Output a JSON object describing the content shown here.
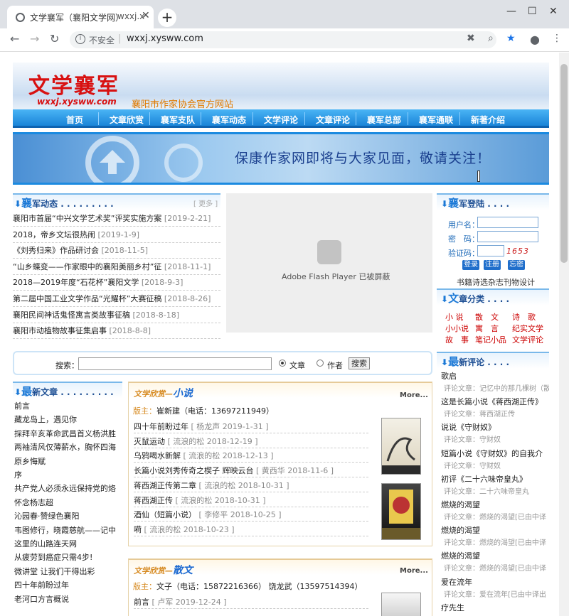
{
  "browser": {
    "tab_title": "文学襄军（襄阳文学网）",
    "tab2_title": "wxxj.x",
    "url": "wxxj.xysww.com",
    "insecure_label": "不安全"
  },
  "header": {
    "logo": "文学襄军",
    "logo_url": "wxxj.xysww.com",
    "slogan": "襄阳市作家协会官方网站"
  },
  "nav": [
    "首页",
    "文章欣赏",
    "襄军支队",
    "襄军动态",
    "文学评论",
    "文章评论",
    "襄军总部",
    "襄军通联",
    "新著介绍"
  ],
  "hero": {
    "text": "保康作家网即将与大家见面，敬请关注！"
  },
  "news": {
    "title_big": "襄",
    "title_rest": "军动态",
    "dots": ". . . . . . . . .",
    "more": "[ 更多 ]",
    "items": [
      {
        "text": "襄阳市首届“中兴文学艺术奖”评奖实施方案",
        "date": "[2019-2-21]"
      },
      {
        "text": "2018，帝乡文坛很热闹",
        "date": "[2019-1-9]"
      },
      {
        "text": "《刘秀归来》作品研讨会",
        "date": "[2018-11-5]"
      },
      {
        "text": "“山乡蝶变——作家眼中的襄阳美丽乡村”征",
        "date": "[2018-11-1]"
      },
      {
        "text": "2018—2019年度“石花杯”襄阳文学",
        "date": "[2018-9-3]"
      },
      {
        "text": "第二届中国工业文学作品“光耀杯”大赛征稿",
        "date": "[2018-8-26]"
      },
      {
        "text": "襄阳民间神话鬼怪寓言类故事征稿",
        "date": "[2018-8-18]"
      },
      {
        "text": "襄阳市动植物故事征集启事",
        "date": "[2018-8-8]"
      }
    ]
  },
  "flash": {
    "text": "Adobe Flash Player 已被屏蔽"
  },
  "login": {
    "title_big": "襄",
    "title_rest": "军登陆",
    "dots": ". . . .",
    "username_label": "用户名：",
    "password_label": "密　码：",
    "captcha_label": "验证码：",
    "captcha_code": "1653",
    "login_btn": "登录",
    "register_btn": "注册",
    "forget_btn": "忘密",
    "note": "书籍诗选杂志刊物设计"
  },
  "categories": {
    "title_big": "文",
    "title_rest": "章分类",
    "dots": ". . . .",
    "rows": [
      [
        "小 说",
        "散　文",
        "诗　歌"
      ],
      [
        "小小说",
        "寓　言",
        "纪实文学"
      ],
      [
        "故　事",
        "笔记小品",
        "文学评论"
      ]
    ]
  },
  "search": {
    "label": "搜索：",
    "opt1": "文章",
    "opt2": "作者",
    "button": "搜索"
  },
  "latest": {
    "title_big": "最",
    "title_rest": "新文章",
    "dots": ". . . . . . . . .",
    "items": [
      "前言",
      "藏龙岛上，遇见你",
      "採拜辛亥革命武昌首义杨洪胜",
      "两袖清风仅薄薪水，胸怀四海",
      "原乡悔赋",
      "序",
      "共产党人必须永远保持党的烙",
      "怀念杨志超",
      "沁园春·赞绿色襄阳",
      "韦图修行，晓霞慈航——记中",
      "这里的山路连天网",
      "从疲劳到癌症只需4步!",
      "微讲堂 让我们干得出彩",
      "四十年前盼过年",
      "老河口方言概说"
    ]
  },
  "section_novel": {
    "prefix": "文学欣赏—",
    "name": "小说",
    "more": "More...",
    "banzhu_label": "版主：",
    "banzhu": "崔新建（电话：13697211949）",
    "items": [
      {
        "text": "四十年前盼过年",
        "meta": "[ 杨龙声  2019-1-31 ]"
      },
      {
        "text": "灭鼠运动",
        "meta": "[ 流浪的松  2018-12-19 ]"
      },
      {
        "text": "乌鸦喝水新解",
        "meta": "[ 流浪的松  2018-12-13 ]"
      },
      {
        "text": "长篇小说刘秀传奇之楔子 辉映云台",
        "meta": "[ 黄西华  2018-11-6 ]"
      },
      {
        "text": "蒋西湖正传第二章",
        "meta": "[ 流浪的松  2018-10-31 ]"
      },
      {
        "text": "蒋西湖正传",
        "meta": "[ 流浪的松  2018-10-31 ]"
      },
      {
        "text": "酒仙（短篇小说）",
        "meta": "[ 李修平  2018-10-25 ]"
      },
      {
        "text": "嗬",
        "meta": "[ 流浪的松  2018-10-23 ]"
      }
    ]
  },
  "section_prose": {
    "prefix": "文学欣赏—",
    "name": "散文",
    "more": "More...",
    "banzhu_label": "版主：",
    "banzhu": "文子（电话：15872216366）  饶龙武（13597514394）",
    "items": [
      {
        "text": "前言",
        "meta": "[ 卢军  2019-12-24 ]"
      }
    ]
  },
  "comments": {
    "title_big": "最",
    "title_rest": "新评论",
    "dots": ". . . .",
    "items": [
      {
        "title": "歌启",
        "comment": "评论文章：记忆中的那几棵树（散"
      },
      {
        "title": "这是长篇小说《蒋西湖正传》",
        "comment": "评论文章：蒋西湖正传"
      },
      {
        "title": "说说《守财奴》",
        "comment": "评论文章：守财奴"
      },
      {
        "title": "短篇小说《守财奴》的自我介",
        "comment": "评论文章：守财奴"
      },
      {
        "title": "初评《二十六味帝皇丸》",
        "comment": "评论文章：二十六味帝皇丸"
      },
      {
        "title": "燃烧的渴望",
        "comment": "评论文章：燃烧的渴望[已由中译"
      },
      {
        "title": "燃烧的渴望",
        "comment": "评论文章：燃烧的渴望[已由中译"
      },
      {
        "title": "燃烧的渴望",
        "comment": "评论文章：燃烧的渴望[已由中译"
      },
      {
        "title": "爱在流年",
        "comment": "评论文章：爱在流年[已由中译出"
      },
      {
        "title": "疗先生",
        "comment": ""
      }
    ]
  }
}
